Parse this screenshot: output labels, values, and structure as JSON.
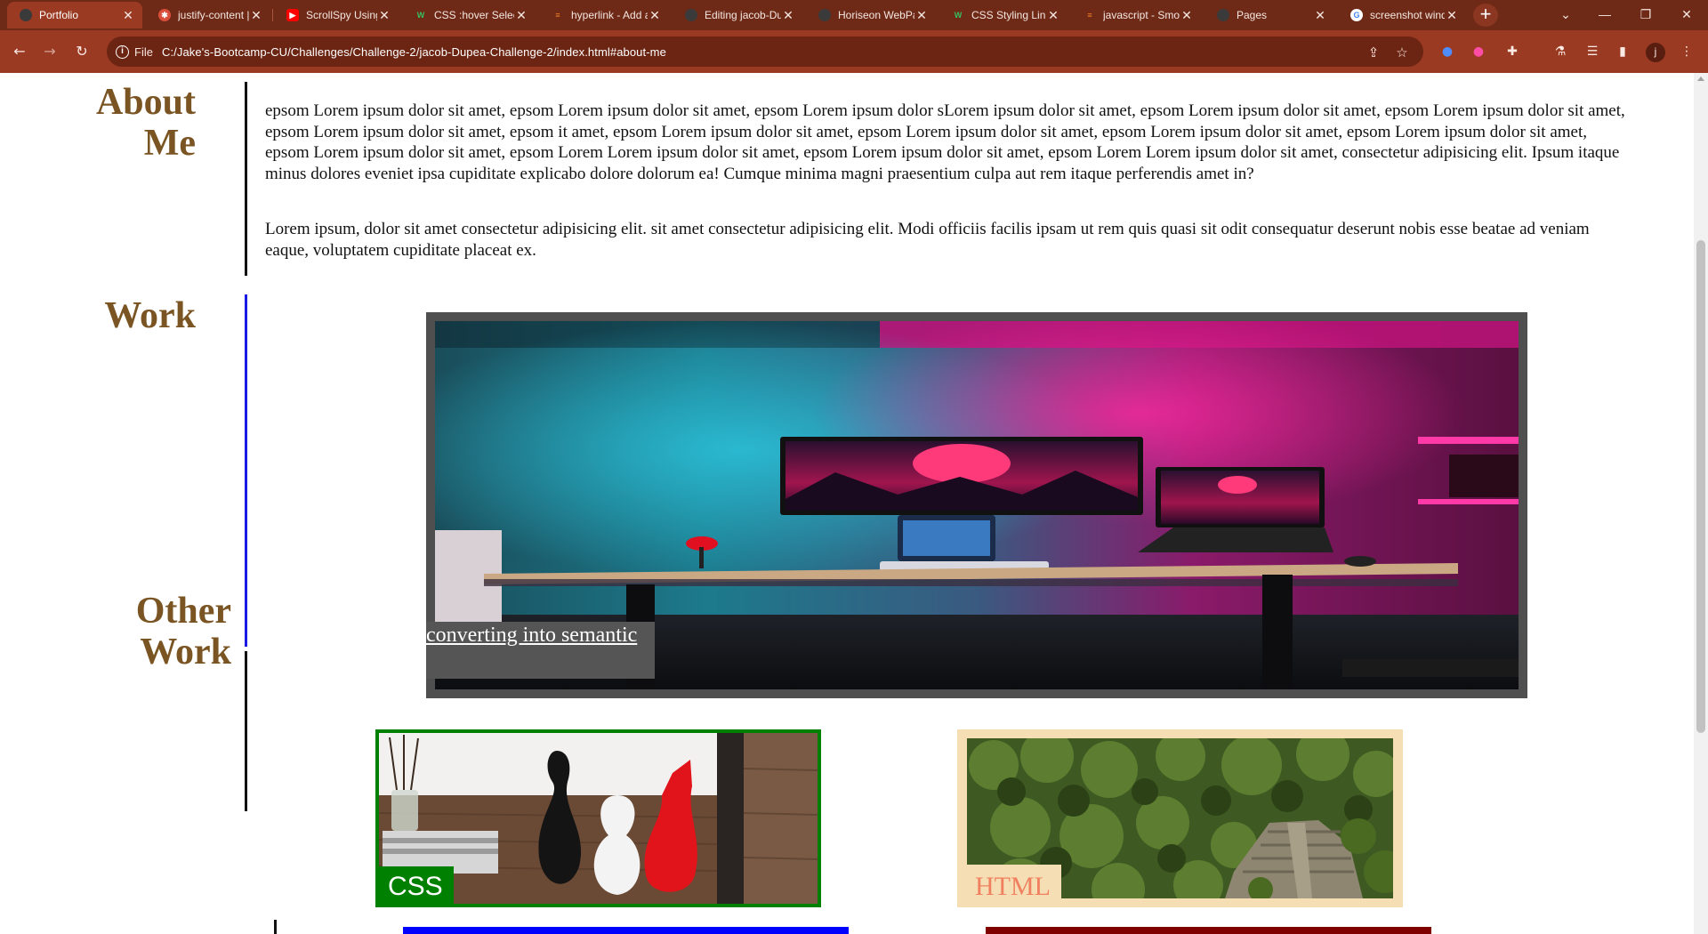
{
  "browser": {
    "tabs": [
      {
        "title": "Portfolio",
        "active": true,
        "icon": "github-icon"
      },
      {
        "title": "justify-content | C",
        "active": false,
        "icon": "asterisk-icon"
      },
      {
        "title": "ScrollSpy Using B",
        "active": false,
        "icon": "youtube-icon"
      },
      {
        "title": "CSS :hover Selec",
        "active": false,
        "icon": "w3schools-icon"
      },
      {
        "title": "hyperlink - Add a",
        "active": false,
        "icon": "stackoverflow-icon"
      },
      {
        "title": "Editing jacob-Du",
        "active": false,
        "icon": "github-icon"
      },
      {
        "title": "Horiseon WebPa",
        "active": false,
        "icon": "github-icon"
      },
      {
        "title": "CSS Styling Links",
        "active": false,
        "icon": "w3schools-icon"
      },
      {
        "title": "javascript - Smo",
        "active": false,
        "icon": "stackoverflow-icon"
      },
      {
        "title": "Pages",
        "active": false,
        "icon": "github-icon"
      },
      {
        "title": "screenshot wind",
        "active": false,
        "icon": "google-icon"
      }
    ],
    "url_scheme": "File",
    "url": "C:/Jake's-Bootcamp-CU/Challenges/Challenge-2/jacob-Dupea-Challenge-2/index.html#about-me",
    "profile_initial": "j"
  },
  "about": {
    "title_line1": "About",
    "title_line2": "Me",
    "para1": "epsom Lorem ipsum dolor sit amet, epsom Lorem ipsum dolor sit amet, epsom Lorem ipsum dolor sLorem ipsum dolor sit amet, epsom Lorem ipsum dolor sit amet, epsom Lorem ipsum dolor sit amet, epsom Lorem ipsum dolor sit amet, epsom it amet, epsom Lorem ipsum dolor sit amet, epsom Lorem ipsum dolor sit amet, epsom Lorem ipsum dolor sit amet, epsom Lorem ipsum dolor sit amet, epsom Lorem ipsum dolor sit amet, epsom Lorem Lorem ipsum dolor sit amet, epsom Lorem ipsum dolor sit amet, epsom Lorem Lorem ipsum dolor sit amet, consectetur adipisicing elit. Ipsum itaque minus dolores eveniet ipsa cupiditate explicabo dolore dolorum ea! Cumque minima magni praesentium culpa aut rem itaque perferendis amet in?",
    "para2": "Lorem ipsum, dolor sit amet consectetur adipisicing elit. sit amet consectetur adipisicing elit. Modi officiis facilis ipsam ut rem quis quasi sit odit consequatur deserunt nobis esse beatae ad veniam eaque, voluptatem cupiditate placeat ex."
  },
  "work": {
    "title": "Work",
    "caption": "converting into semantic"
  },
  "other_work": {
    "title_line1": "Other",
    "title_line2": "Work",
    "cards": [
      {
        "label": "CSS"
      },
      {
        "label": "HTML"
      }
    ]
  },
  "colors": {
    "chrome_dark": "#6e2a17",
    "chrome_toolbar": "#9a3a22",
    "heading": "#7a5523",
    "work_rule": "#1a1ae6",
    "css_card": "#008000",
    "html_card": "#f5deb3",
    "html_label": "#f08060",
    "blue_card": "#0000ff",
    "maroon_card": "#800000"
  }
}
